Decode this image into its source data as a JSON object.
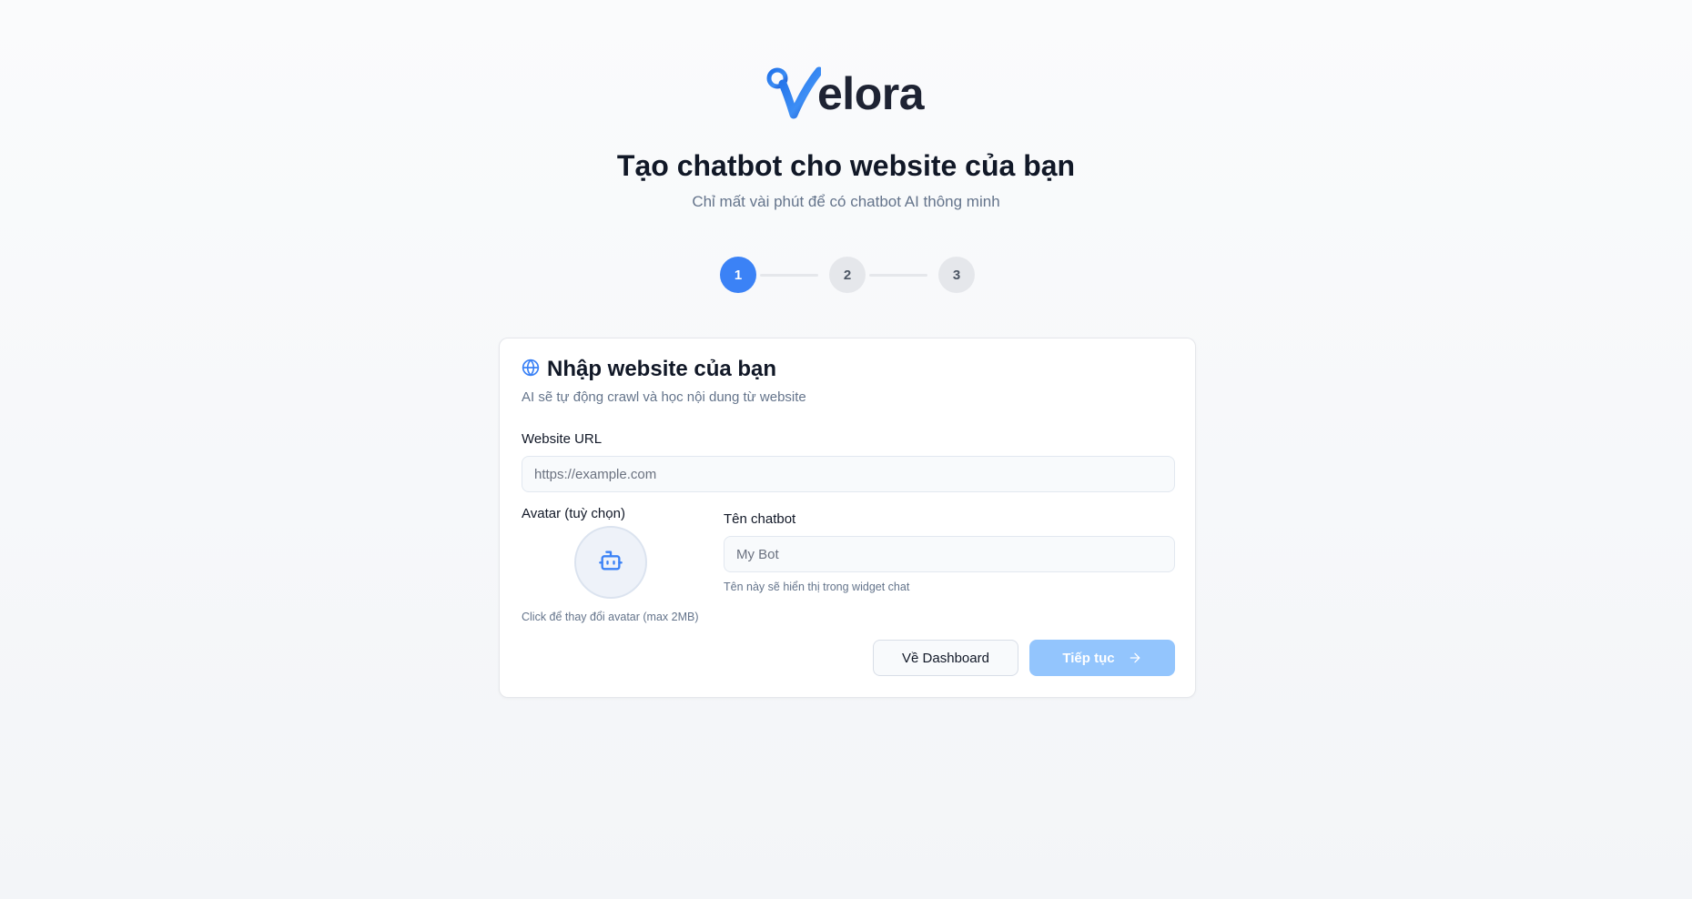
{
  "brand": {
    "logo_letter": "V",
    "name": "elora",
    "primary_color": "#3b82f6",
    "disabled_primary_color": "#93c5fd"
  },
  "header": {
    "title": "Tạo chatbot cho website của bạn",
    "subtitle": "Chỉ mất vài phút để có chatbot AI thông minh"
  },
  "stepper": {
    "steps": [
      {
        "label": "1",
        "state": "active"
      },
      {
        "label": "2",
        "state": "inactive"
      },
      {
        "label": "3",
        "state": "inactive"
      }
    ]
  },
  "card": {
    "icon": "globe-icon",
    "title": "Nhập website của bạn",
    "description": "AI sẽ tự động crawl và học nội dung từ website",
    "website": {
      "label": "Website URL",
      "placeholder": "https://example.com",
      "value": ""
    },
    "avatar": {
      "label": "Avatar (tuỳ chọn)",
      "icon": "bot-icon",
      "hint": "Click để thay đổi avatar (max 2MB)"
    },
    "chatbot_name": {
      "label": "Tên chatbot",
      "placeholder": "My Bot",
      "value": "",
      "hint": "Tên này sẽ hiển thị trong widget chat"
    },
    "actions": {
      "back_label": "Về Dashboard",
      "next_label": "Tiếp tục",
      "next_icon": "arrow-right-icon"
    }
  }
}
